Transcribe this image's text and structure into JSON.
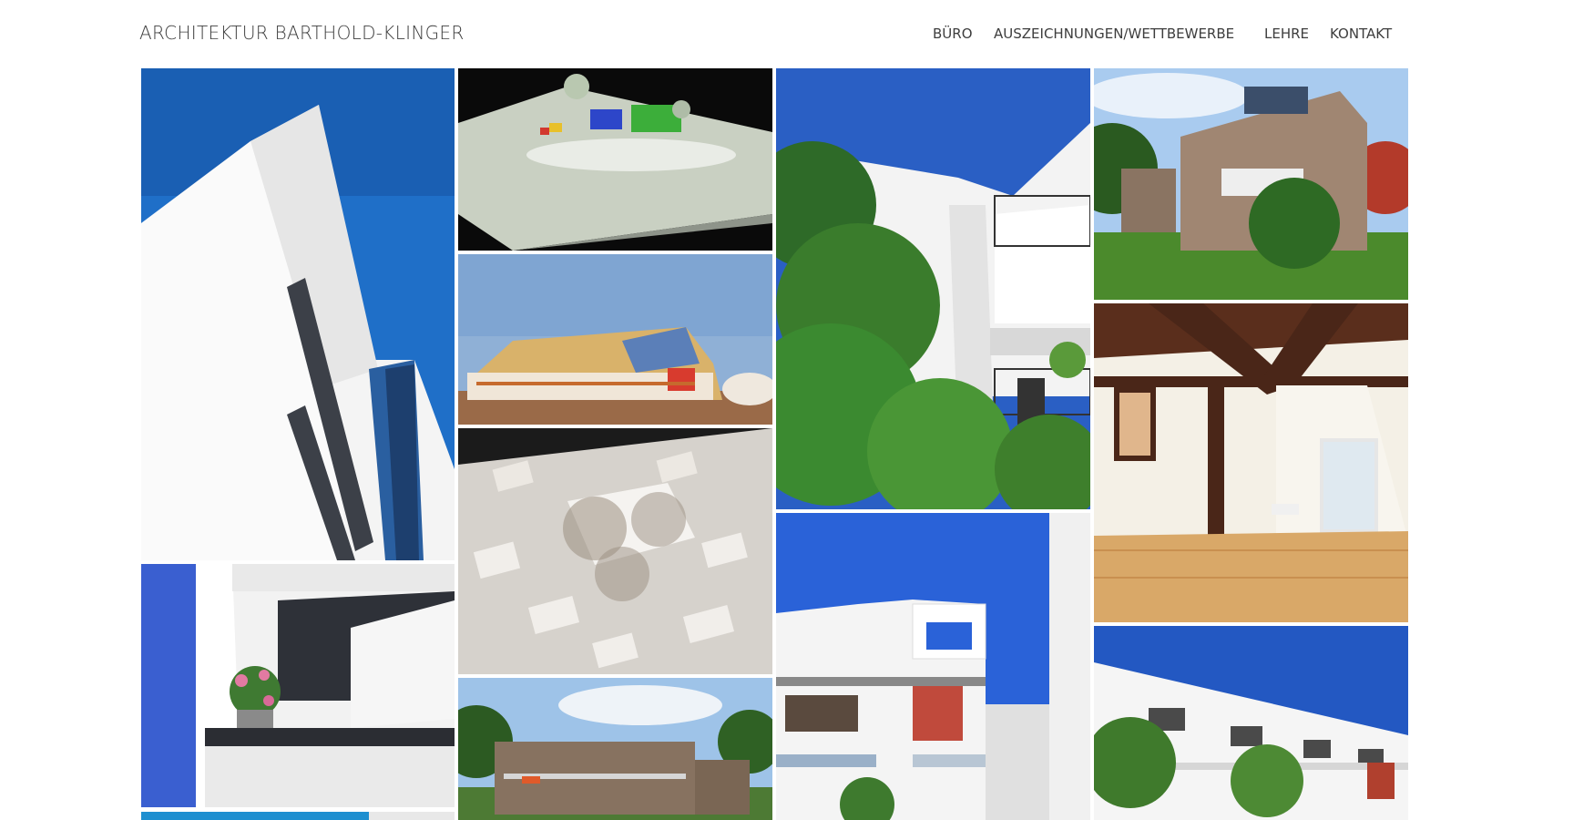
{
  "site": {
    "logo": "ARCHITEKTUR BARTHOLD-KLINGER"
  },
  "nav": {
    "items": [
      "BÜRO",
      "AUSZEICHNUNGEN/WETTBEWERBE",
      "LEHRE",
      "KONTAKT"
    ]
  },
  "colors": {
    "text": "#3d3d3d",
    "sky": "#1e70c8",
    "background": "#ffffff"
  }
}
